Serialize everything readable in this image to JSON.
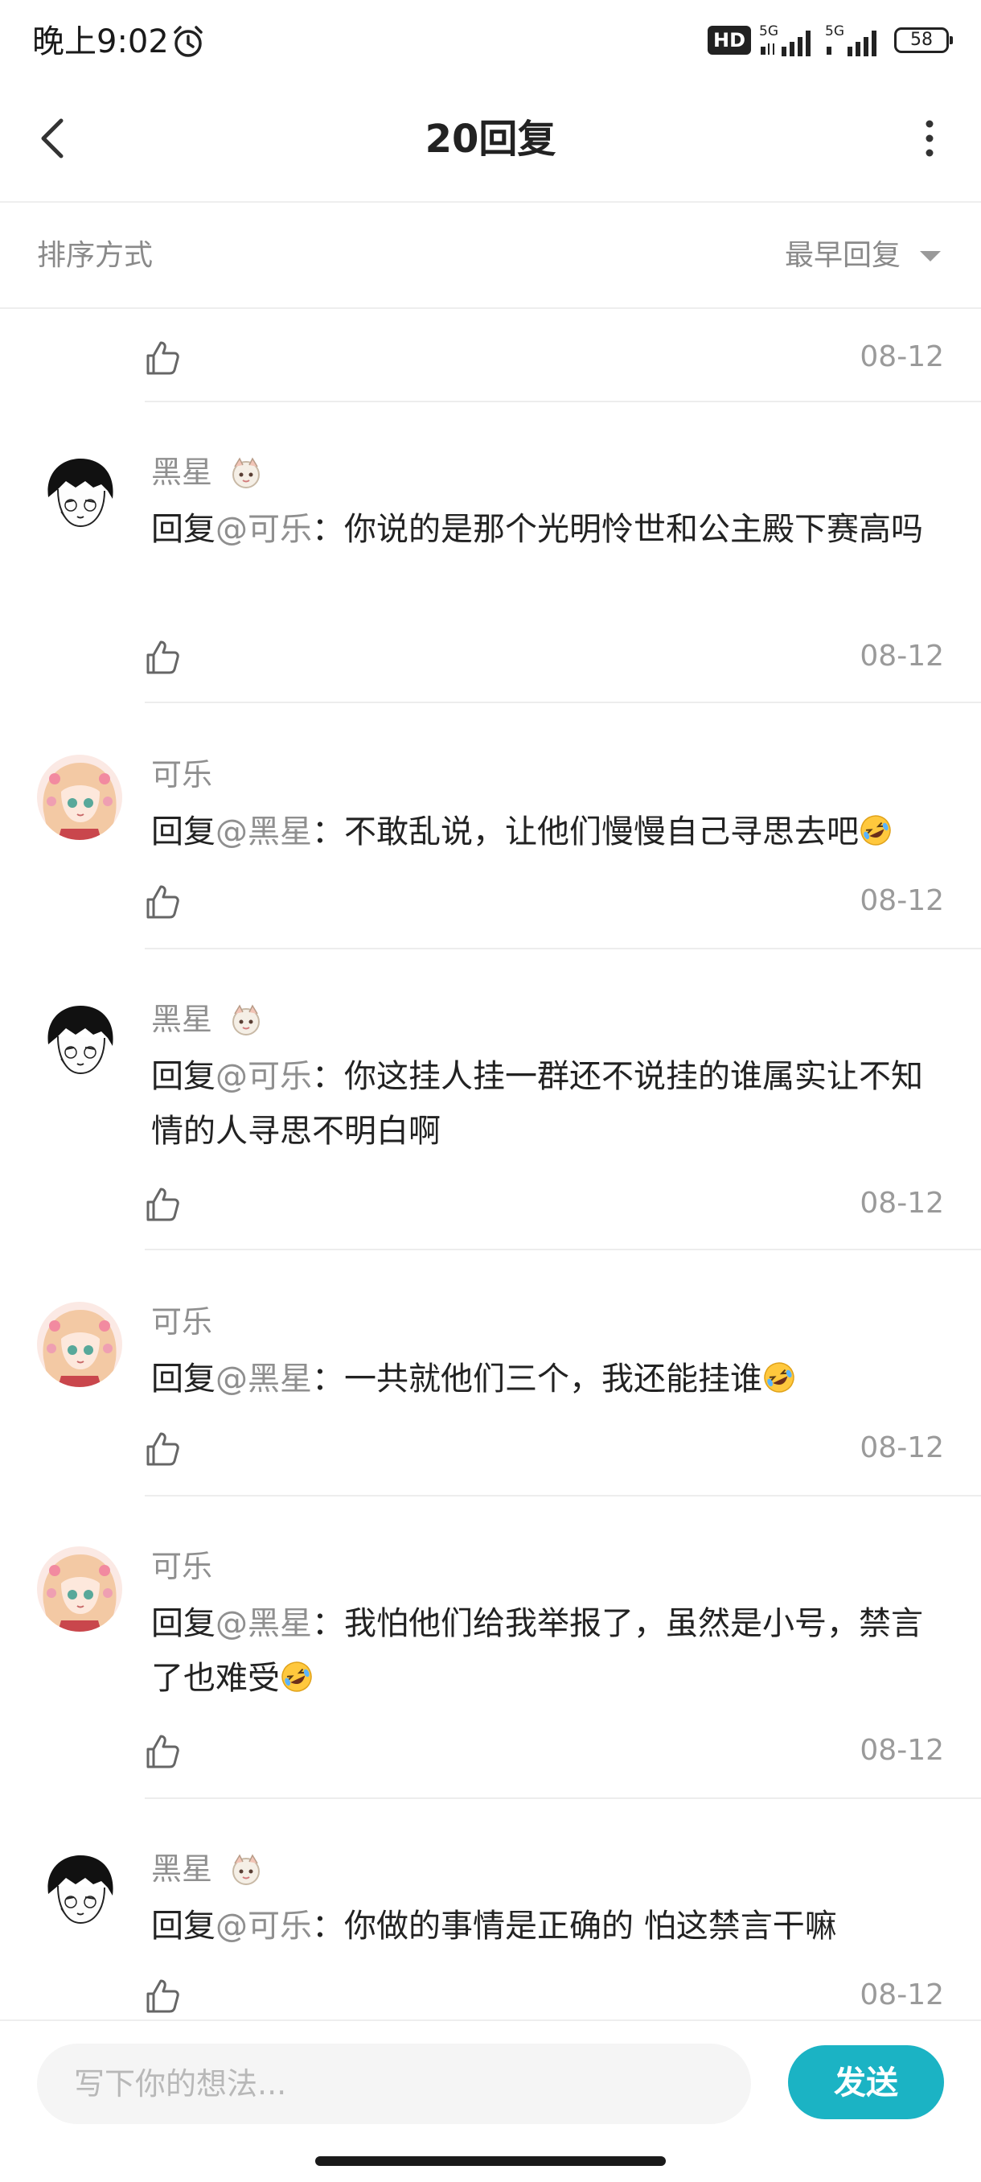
{
  "status_bar": {
    "time": "晚上9:02",
    "hd_label": "HD",
    "network_1": "5G",
    "network_2": "5G",
    "battery": "58"
  },
  "header": {
    "title": "20回复"
  },
  "sort": {
    "label": "排序方式",
    "value": "最早回复"
  },
  "comments": [
    {
      "date": "08-12"
    },
    {
      "user": "黑星",
      "reply_prefix": "回复",
      "mention": "@可乐",
      "colon": "：",
      "text": "你说的是那个光明怜世和公主殿下赛高吗",
      "date": "08-12"
    },
    {
      "user": "可乐",
      "reply_prefix": "回复",
      "mention": "@黑星",
      "colon": "：",
      "text": "不敢乱说，让他们慢慢自己寻思去吧",
      "date": "08-12"
    },
    {
      "user": "黑星",
      "reply_prefix": "回复",
      "mention": "@可乐",
      "colon": "：",
      "text": "你这挂人挂一群还不说挂的谁属实让不知情的人寻思不明白啊",
      "date": "08-12"
    },
    {
      "user": "可乐",
      "reply_prefix": "回复",
      "mention": "@黑星",
      "colon": "：",
      "text": "一共就他们三个，我还能挂谁",
      "date": "08-12"
    },
    {
      "user": "可乐",
      "reply_prefix": "回复",
      "mention": "@黑星",
      "colon": "：",
      "text": "我怕他们给我举报了，虽然是小号，禁言了也难受",
      "date": "08-12"
    },
    {
      "user": "黑星",
      "reply_prefix": "回复",
      "mention": "@可乐",
      "colon": "：",
      "text": "你做的事情是正确的 怕这禁言干嘛",
      "date": "08-12"
    }
  ],
  "input": {
    "placeholder": "写下你的想法...",
    "send_label": "发送"
  },
  "colors": {
    "accent": "#1bb3c4",
    "secondary_text": "#8f8f8f",
    "divider": "#ededed"
  },
  "icons": {
    "back": "chevron-left-icon",
    "more": "more-vertical-icon",
    "like": "thumbs-up-icon",
    "alarm": "alarm-clock-icon",
    "emoji": "rolling-laughing-emoji"
  }
}
